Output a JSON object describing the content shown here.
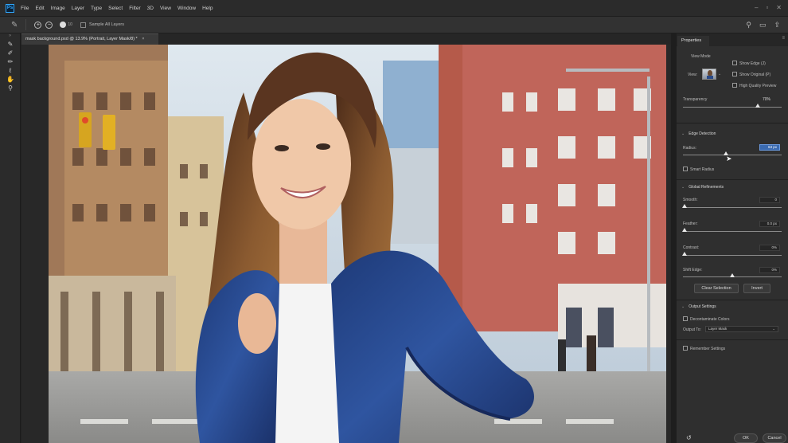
{
  "app": {
    "logo_text": "Ps",
    "menu": [
      "File",
      "Edit",
      "Image",
      "Layer",
      "Type",
      "Select",
      "Filter",
      "3D",
      "View",
      "Window",
      "Help"
    ],
    "window_controls": [
      "–",
      "▫",
      "✕"
    ]
  },
  "options_bar": {
    "sample_all_layers_label": "Sample All Layers",
    "brush_size": "10"
  },
  "document": {
    "tab_title": "mask background.psd @ 13.9% (Portrait, Layer Mask/8) *",
    "close_glyph": "×"
  },
  "properties": {
    "tab_label": "Properties",
    "view_mode": {
      "heading": "View Mode",
      "view_label": "View:",
      "show_edge_label": "Show Edge (J)",
      "show_original_label": "Show Original (P)",
      "high_quality_label": "High Quality Preview"
    },
    "transparency": {
      "label": "Transparency",
      "value": "70%",
      "level_fraction": 0.7
    },
    "edge_detection": {
      "heading": "Edge Detection",
      "radius_label": "Radius:",
      "radius_value": "63 px",
      "radius_fraction": 0.4,
      "smart_radius_label": "Smart Radius"
    },
    "global_refinements": {
      "heading": "Global Refinements",
      "smooth_label": "Smooth:",
      "smooth_value": "0",
      "feather_label": "Feather:",
      "feather_value": "0.0 px",
      "contrast_label": "Contrast:",
      "contrast_value": "0%",
      "shift_edge_label": "Shift Edge:",
      "shift_edge_value": "0%",
      "shift_edge_fraction": 0.5,
      "clear_selection_label": "Clear Selection",
      "invert_label": "Invert"
    },
    "output_settings": {
      "heading": "Output Settings",
      "decontaminate_label": "Decontaminate Colors",
      "output_to_label": "Output To:",
      "output_to_value": "Layer Mask",
      "remember_label": "Remember Settings"
    },
    "footer": {
      "ok_label": "OK",
      "cancel_label": "Cancel"
    }
  },
  "colors": {
    "accent": "#31a8ff",
    "panel_bg": "#2f2f2f",
    "field_highlight": "#3a6ab0",
    "jacket_blue": "#2a4a88"
  }
}
